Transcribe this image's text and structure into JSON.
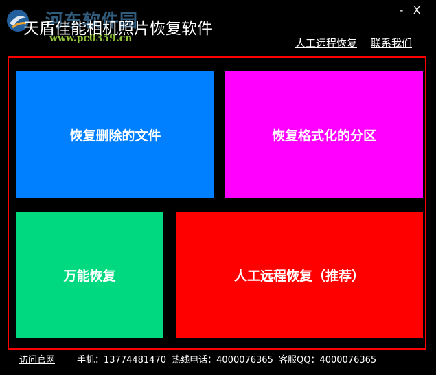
{
  "watermark": {
    "title": "河东软件园",
    "url": "www.pc0359.cn"
  },
  "window": {
    "title": "天盾佳能相机照片恢复软件",
    "minimize_label": "-",
    "close_label": "X"
  },
  "header_links": {
    "remote": "人工远程恢复",
    "contact": "联系我们"
  },
  "tiles": [
    {
      "label": "恢复删除的文件",
      "color": "#0080ff"
    },
    {
      "label": "恢复格式化的分区",
      "color": "#ff00ff"
    },
    {
      "label": "万能恢复",
      "color": "#00d97f"
    },
    {
      "label": "人工远程恢复（推荐）",
      "color": "#ff0000"
    }
  ],
  "frame_color": "#ff0000",
  "footer": {
    "site_link": "访问官网",
    "phone": "手机：13774481470",
    "hotline": "热线电话：4000076365",
    "qq": "客服QQ：4000076365"
  }
}
